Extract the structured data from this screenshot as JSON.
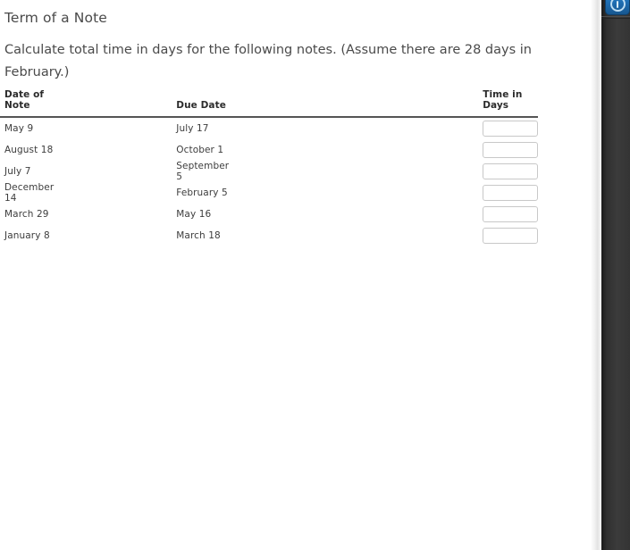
{
  "page": {
    "title": "Term of a Note",
    "instructions": "Calculate total time in days for the following notes. (Assume there are 28 days in February.)"
  },
  "table": {
    "headers": {
      "date_of_note": "Date of Note",
      "due_date": "Due Date",
      "time_in_days": "Time in Days"
    },
    "rows": [
      {
        "date_of_note": "May 9",
        "due_date": "July 17",
        "time_in_days": ""
      },
      {
        "date_of_note": "August 18",
        "due_date": "October 1",
        "time_in_days": ""
      },
      {
        "date_of_note": "July 7",
        "due_date": "September 5",
        "time_in_days": ""
      },
      {
        "date_of_note": "December 14",
        "due_date": "February 5",
        "time_in_days": ""
      },
      {
        "date_of_note": "March 29",
        "due_date": "May 16",
        "time_in_days": ""
      },
      {
        "date_of_note": "January 8",
        "due_date": "March 18",
        "time_in_days": ""
      }
    ]
  },
  "right_panel": {
    "info_button_icon": "info-circle-icon"
  },
  "colors": {
    "title_text": "#4a4a4a",
    "body_text": "#4a4a4a",
    "table_header_text": "#2b2b2b",
    "table_rule": "#555555",
    "input_border": "#c8c8c8",
    "panel_background": "#3b3b3b",
    "info_button": "#1f6fb4"
  }
}
